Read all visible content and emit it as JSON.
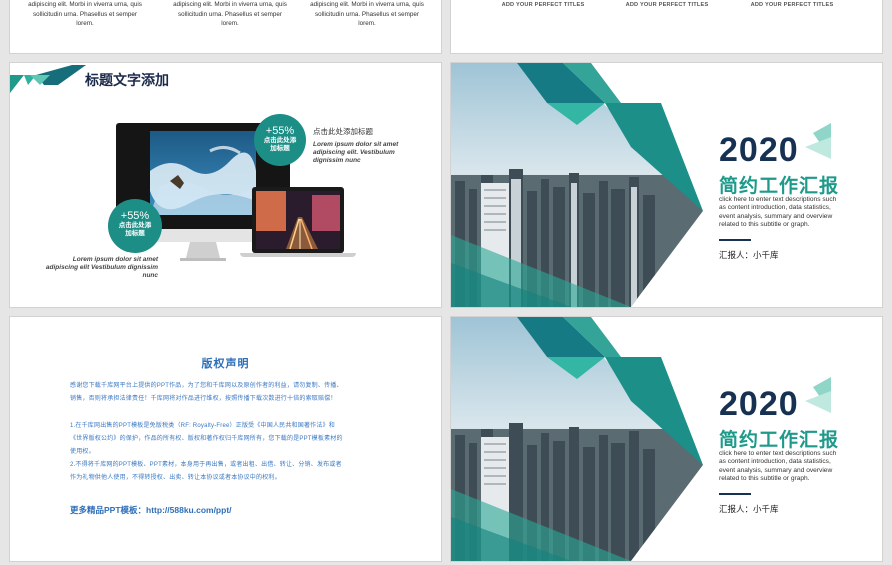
{
  "top_left": {
    "columns": [
      {
        "line1": "adipiscing elit. Morbi in viverra urna, quis",
        "line2": "sollicitudin urna. Phasellus et semper",
        "line3": "lorem."
      },
      {
        "line1": "adipiscing elit. Morbi in viverra urna, quis",
        "line2": "sollicitudin urna. Phasellus et semper",
        "line3": "lorem."
      },
      {
        "line1": "adipiscing elit. Morbi in viverra urna, quis",
        "line2": "sollicitudin urna. Phasellus et semper",
        "line3": "lorem."
      }
    ]
  },
  "top_right": {
    "titles": [
      "ADD YOUR PERFECT TITLES",
      "ADD YOUR PERFECT TITLES",
      "ADD YOUR PERFECT TITLES"
    ]
  },
  "devices_slide": {
    "title": "标题文字添加",
    "badge_top": {
      "percent": "+55%",
      "line1": "点击此处添",
      "line2": "加标题"
    },
    "badge_bottom": {
      "percent": "+55%",
      "line1": "点击此处添",
      "line2": "加标题"
    },
    "right_heading": "点击此处添加标题",
    "right_text": [
      "Lorem ipsum dolor sit amet",
      "adipiscing elit. Vestibulum",
      "dignissim nunc"
    ],
    "left_text": [
      "Lorem ipsum dolor sit amet",
      "adipiscing elit Vestibulum dignissim",
      "nunc"
    ]
  },
  "cover_1": {
    "year": "2020",
    "title": "简约工作汇报",
    "desc": [
      "click here to enter text descriptions such",
      "as content introduction, data statistics,",
      "event analysis, summary and overview",
      "related to this subtitle or graph."
    ],
    "reporter": "汇报人：小千库"
  },
  "cover_2": {
    "year": "2020",
    "title": "简约工作汇报",
    "desc": [
      "click here to enter text descriptions such",
      "as content introduction, data statistics,",
      "event analysis, summary and overview",
      "related to this subtitle or graph."
    ],
    "reporter": "汇报人：小千库"
  },
  "copyright": {
    "title": "版权声明",
    "para1": [
      "感谢您下载千库网平台上提供的PPT作品，为了您和千库网以及原创作者的利益，请勿复制、传播、",
      "销售，否则将承担法律责任！千库网将对作品进行维权，按照传播下载次数进行十倍的索取赔偿！"
    ],
    "para2": [
      "1.在千库网出售的PPT模板是免版税类（RF: Royalty-Free）正版受《中国人民共和国著作法》和",
      "《世界版权公约》的保护，作品的所有权、版权和著作权归千库网所有，您下载的是PPT模板素材的",
      "使用权。"
    ],
    "para3": [
      "2.不得将千库网的PPT模板、PPT素材，本身用于再出售，或者出租、出借、转让、分销、发布或者",
      "作为礼物供他人使用，不得转授权、出卖、转让本协议或者本协议中的权利。"
    ],
    "link": "更多精品PPT模板：http://588ku.com/ppt/"
  },
  "colors": {
    "teal": "#1e9a8b",
    "navy": "#173153",
    "blue_text": "#2f6fb8"
  }
}
